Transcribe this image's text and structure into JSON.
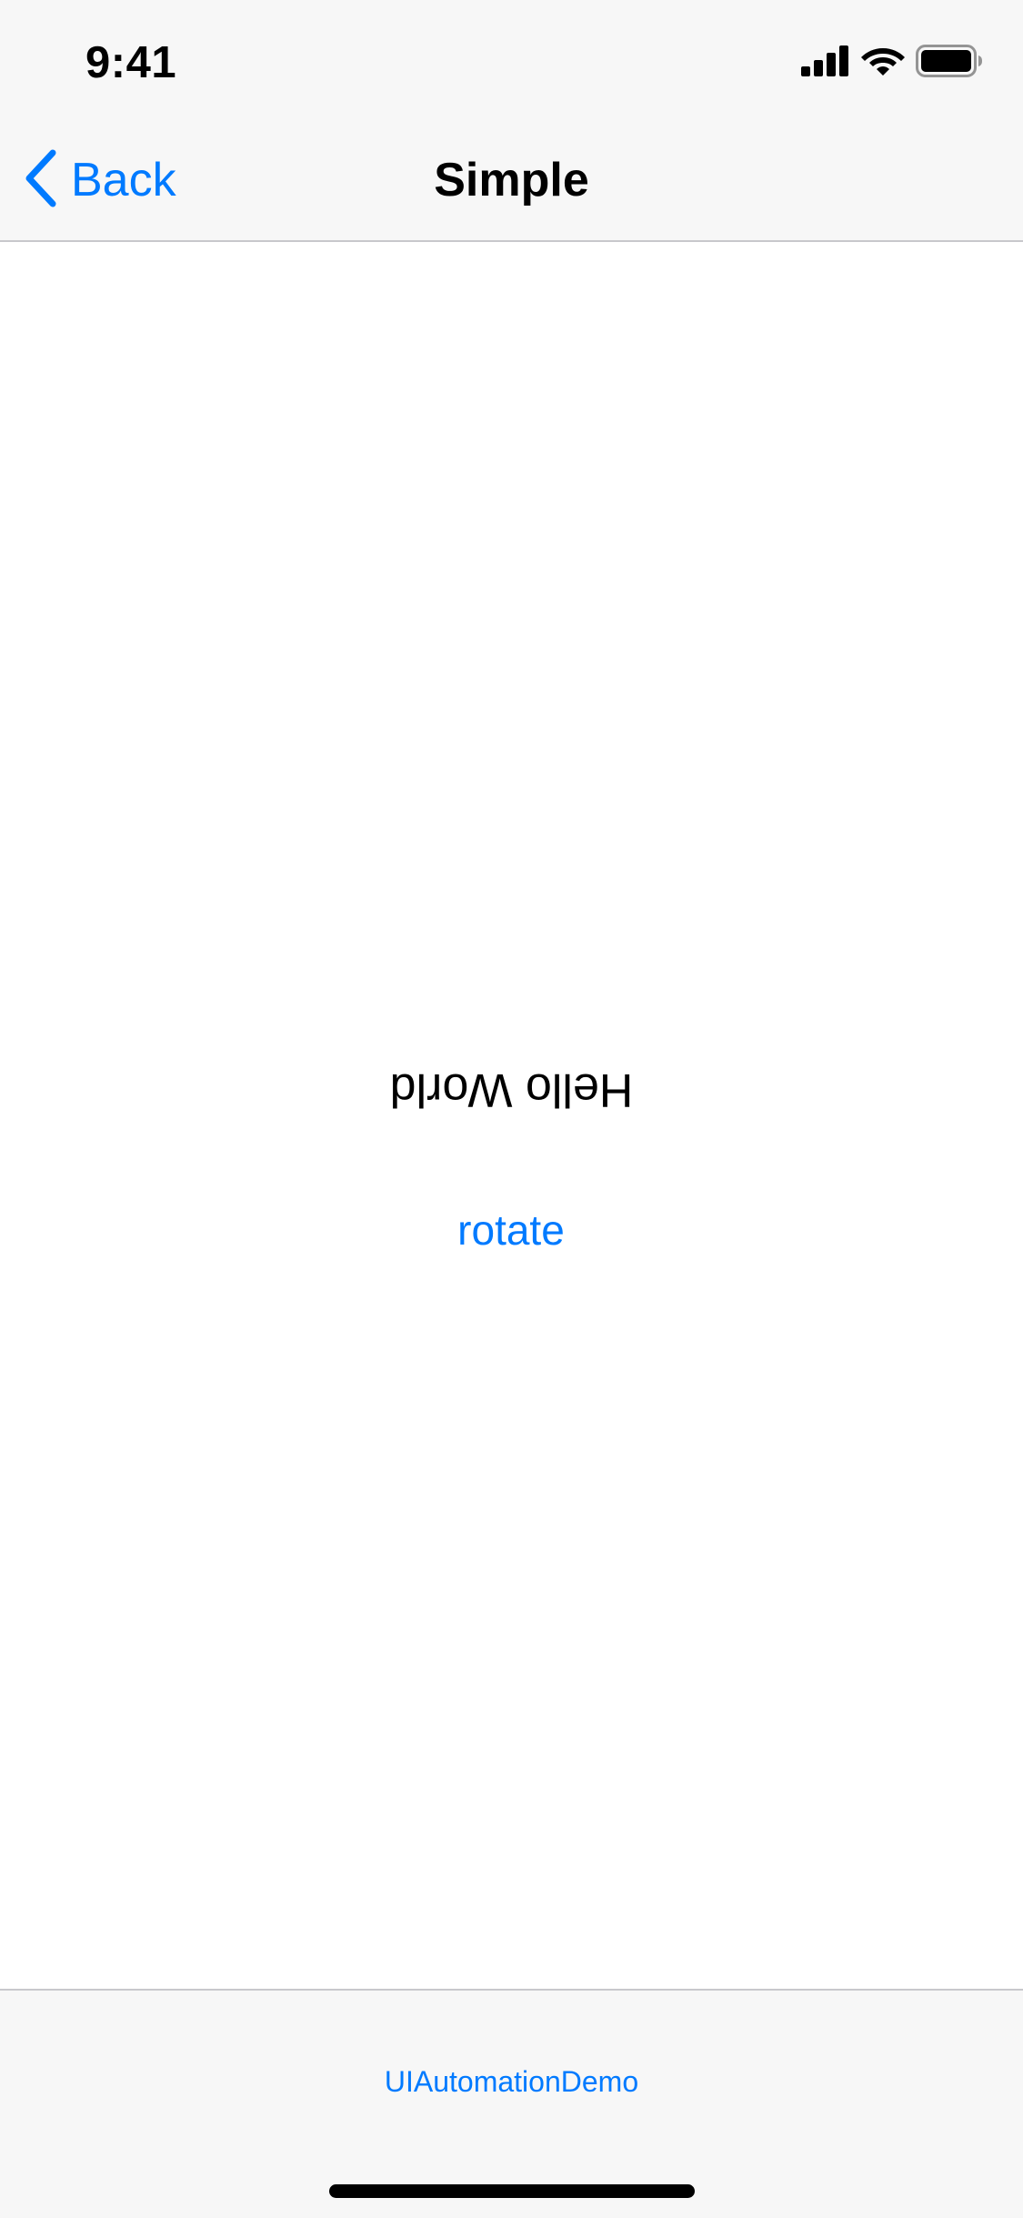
{
  "status_bar": {
    "time": "9:41",
    "icons": [
      "signal-icon",
      "wifi-icon",
      "battery-icon"
    ]
  },
  "nav_bar": {
    "back_label": "Back",
    "back_icon": "chevron-left-icon",
    "title": "Simple"
  },
  "content": {
    "hello_label": "Hello World",
    "rotate_button_label": "rotate"
  },
  "tab_bar": {
    "item_label": "UIAutomationDemo"
  },
  "colors": {
    "accent": "#007aff",
    "bar_background": "#f7f7f7",
    "separator": "#c8c8cc",
    "text": "#000000"
  }
}
